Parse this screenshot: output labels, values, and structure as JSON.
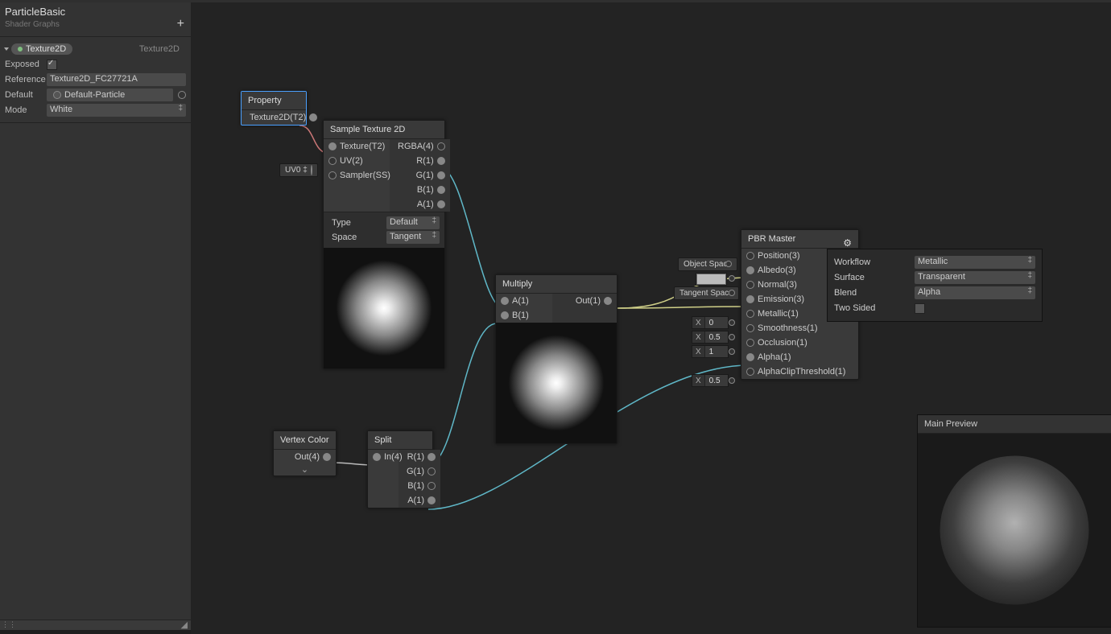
{
  "blackboard": {
    "title": "ParticleBasic",
    "subtitle": "Shader Graphs",
    "add": "+",
    "prop": {
      "name": "Texture2D",
      "type": "Texture2D"
    },
    "exposedLabel": "Exposed",
    "exposedChecked": true,
    "referenceLabel": "Reference",
    "referenceValue": "Texture2D_FC27721A",
    "defaultLabel": "Default",
    "defaultValue": "Default-Particle",
    "modeLabel": "Mode",
    "modeValue": "White"
  },
  "nodes": {
    "property": {
      "title": "Property",
      "out": "Texture2D(T2)"
    },
    "sample": {
      "title": "Sample Texture 2D",
      "in": [
        "Texture(T2)",
        "UV(2)",
        "Sampler(SS)"
      ],
      "out": [
        "RGBA(4)",
        "R(1)",
        "G(1)",
        "B(1)",
        "A(1)"
      ],
      "typeLabel": "Type",
      "typeValue": "Default",
      "spaceLabel": "Space",
      "spaceValue": "Tangent",
      "uvpin": "UV0"
    },
    "multiply": {
      "title": "Multiply",
      "inA": "A(1)",
      "inB": "B(1)",
      "out": "Out(1)"
    },
    "vertexcolor": {
      "title": "Vertex Color",
      "out": "Out(4)"
    },
    "split": {
      "title": "Split",
      "in": "In(4)",
      "out": [
        "R(1)",
        "G(1)",
        "B(1)",
        "A(1)"
      ]
    },
    "pbr": {
      "title": "PBR Master",
      "ports": [
        "Position(3)",
        "Albedo(3)",
        "Normal(3)",
        "Emission(3)",
        "Metallic(1)",
        "Smoothness(1)",
        "Occlusion(1)",
        "Alpha(1)",
        "AlphaClipThreshold(1)"
      ],
      "pinSpace1": "Object Space",
      "pinSpace2": "Tangent Space",
      "pinMetallic": "0",
      "pinSmooth": "0.5",
      "pinOccl": "1",
      "pinClip": "0.5"
    }
  },
  "settings": {
    "workflowLabel": "Workflow",
    "workflowValue": "Metallic",
    "surfaceLabel": "Surface",
    "surfaceValue": "Transparent",
    "blendLabel": "Blend",
    "blendValue": "Alpha",
    "twoSidedLabel": "Two Sided",
    "twoSidedChecked": false
  },
  "mainPreview": "Main Preview"
}
